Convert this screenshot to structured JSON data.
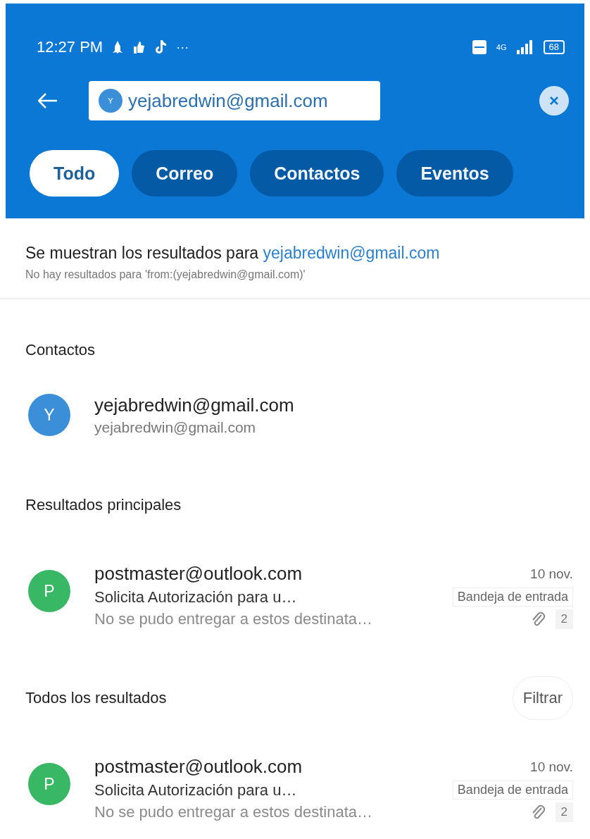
{
  "status_bar": {
    "time": "12:27 PM",
    "more": "···",
    "network": "4G",
    "battery": "68"
  },
  "search": {
    "chip_initial": "Y",
    "value": "yejabredwin@gmail.com"
  },
  "tabs": [
    {
      "label": "Todo",
      "selected": true
    },
    {
      "label": "Correo",
      "selected": false
    },
    {
      "label": "Contactos",
      "selected": false
    },
    {
      "label": "Eventos",
      "selected": false
    }
  ],
  "notice": {
    "text": "Se muestran los resultados para",
    "query": "yejabredwin@gmail.com",
    "subtext": "No hay resultados para 'from:(yejabredwin@gmail.com)'"
  },
  "sections": [
    {
      "title": "Contactos",
      "kind": "contacts",
      "items": [
        {
          "initial": "Y",
          "name": "yejabredwin@gmail.com",
          "email": "yejabredwin@gmail.com",
          "color": "#3b8fd9"
        }
      ]
    },
    {
      "title": "Resultados principales",
      "kind": "mail",
      "items": [
        {
          "initial": "P",
          "color": "#38b865",
          "sender": "postmaster@outlook.com",
          "date": "10 nov.",
          "subject": "Solicita Autorización para u…",
          "folder": "Bandeja de entrada",
          "preview": "No se pudo entregar a estos destinata…",
          "attachment": true,
          "count": "2"
        }
      ]
    },
    {
      "title": "Todos los resultados",
      "kind": "mail",
      "action": "Filtrar",
      "items": [
        {
          "initial": "P",
          "color": "#38b865",
          "sender": "postmaster@outlook.com",
          "date": "10 nov.",
          "subject": "Solicita Autorización para u…",
          "folder": "Bandeja de entrada",
          "preview": "No se pudo entregar a estos destinata…",
          "attachment": true,
          "count": "2"
        }
      ]
    }
  ]
}
